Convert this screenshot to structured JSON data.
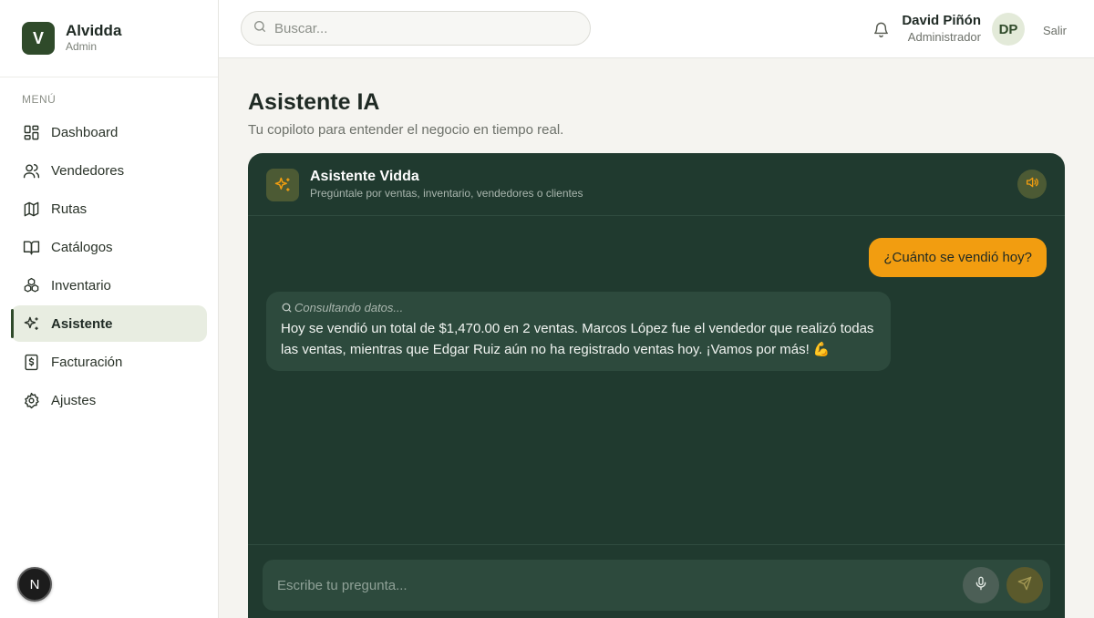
{
  "brand": {
    "logo_letter": "V",
    "name": "Alvidda",
    "role": "Admin"
  },
  "sidebar": {
    "menu_label": "MENÚ",
    "items": [
      {
        "label": "Dashboard",
        "icon": "dashboard-icon",
        "active": false
      },
      {
        "label": "Vendedores",
        "icon": "users-icon",
        "active": false
      },
      {
        "label": "Rutas",
        "icon": "map-icon",
        "active": false
      },
      {
        "label": "Catálogos",
        "icon": "book-icon",
        "active": false
      },
      {
        "label": "Inventario",
        "icon": "boxes-icon",
        "active": false
      },
      {
        "label": "Asistente",
        "icon": "sparkles-icon",
        "active": true
      },
      {
        "label": "Facturación",
        "icon": "receipt-icon",
        "active": false
      },
      {
        "label": "Ajustes",
        "icon": "gear-icon",
        "active": false
      }
    ],
    "badge": "N"
  },
  "topbar": {
    "search_placeholder": "Buscar...",
    "user_name": "David Piñón",
    "user_role": "Administrador",
    "avatar_initials": "DP",
    "logout_label": "Salir"
  },
  "page": {
    "title": "Asistente IA",
    "subtitle": "Tu copiloto para entender el negocio en tiempo real."
  },
  "chat": {
    "bot_name": "Asistente Vidda",
    "bot_subtitle": "Pregúntale por ventas, inventario, vendedores o clientes",
    "user_message": "¿Cuánto se vendió hoy?",
    "bot_status": "Consultando datos...",
    "bot_answer": "Hoy se vendió un total de $1,470.00 en 2 ventas. Marcos López fue el vendedor que realizó todas las ventas, mientras que Edgar Ruiz aún no ha registrado ventas hoy. ¡Vamos por más! 💪",
    "input_placeholder": "Escribe tu pregunta..."
  },
  "colors": {
    "brand_green": "#2f4a2a",
    "chat_bg": "#203a2f",
    "accent_orange": "#f29d10",
    "active_nav_bg": "#e8ede1"
  }
}
